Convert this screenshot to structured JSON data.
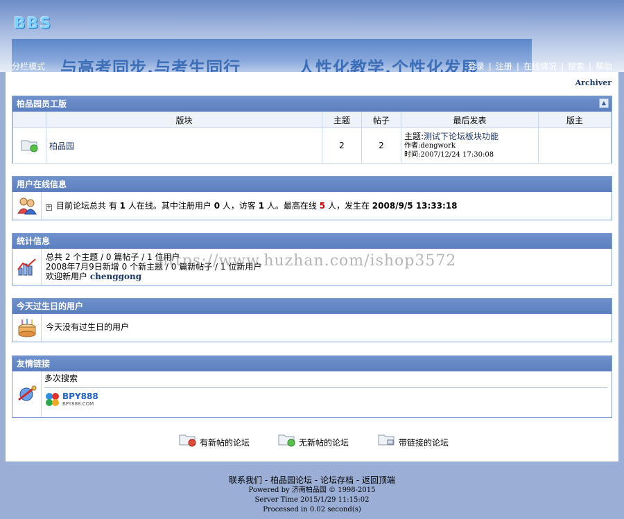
{
  "header": {
    "logo_text": "BBS",
    "banner_left": "与高考同步,与考生同行",
    "banner_right": "人性化教学,个性化发展",
    "mode_link": "分栏模式",
    "nav": [
      "登录",
      "注册",
      "在线情况",
      "搜索",
      "帮助"
    ],
    "nav_sep": "|"
  },
  "archiver": "Archiver",
  "forum_section": {
    "title": "柏品园员工版",
    "columns": [
      "版块",
      "主题",
      "帖子",
      "最后发表",
      "版主"
    ],
    "rows": [
      {
        "name": "柏品园",
        "topics": "2",
        "posts": "2",
        "last_topic_prefix": "主题:",
        "last_topic": "测试下论坛板块功能",
        "last_author": "作者:dengwork",
        "last_time": "时间:2007/12/24 17:30:08",
        "moderator": ""
      }
    ]
  },
  "online": {
    "title": "用户在线信息",
    "text_a": "目前论坛总共 有",
    "total": "1",
    "text_b": "人在线。其中注册用户",
    "registered": "0",
    "text_c": "人，访客",
    "guests": "1",
    "text_d": "人。最高在线",
    "max": "5",
    "text_e": "人，发生在",
    "max_time": "2008/9/5 13:33:18"
  },
  "stats": {
    "title": "统计信息",
    "line1": "总共 2 个主题 / 0 篇帖子 / 1 位用户",
    "line2": "2008年7月9日新增 0 个新主题 / 0 篇新帖子 / 1 位新用户",
    "welcome": "欢迎新用户",
    "new_user": "chenggong"
  },
  "birthday": {
    "title": "今天过生日的用户",
    "text": "今天没有过生日的用户"
  },
  "links": {
    "title": "友情链接",
    "item": "多次搜索",
    "logo_text": "BPY888",
    "logo_sub": "BPY888.COM"
  },
  "legend": [
    "有新帖的论坛",
    "无新帖的论坛",
    "带链接的论坛"
  ],
  "watermark": "https://www.huzhan.com/ishop3572",
  "footer": {
    "links": [
      "联系我们",
      "柏品园论坛",
      "论坛存档",
      "返回顶端"
    ],
    "link_sep": " - ",
    "powered": "Powered by 济南柏品园 © 1998-2015",
    "server_time": "Server Time 2015/1/29 11:15:02",
    "processed": "Processed in 0.02 second(s)"
  },
  "colors": {
    "title_bar": "#5b7fbf",
    "page_bg": "#9aaed6",
    "accent_red": "#c00000",
    "link": "#1b3566"
  }
}
